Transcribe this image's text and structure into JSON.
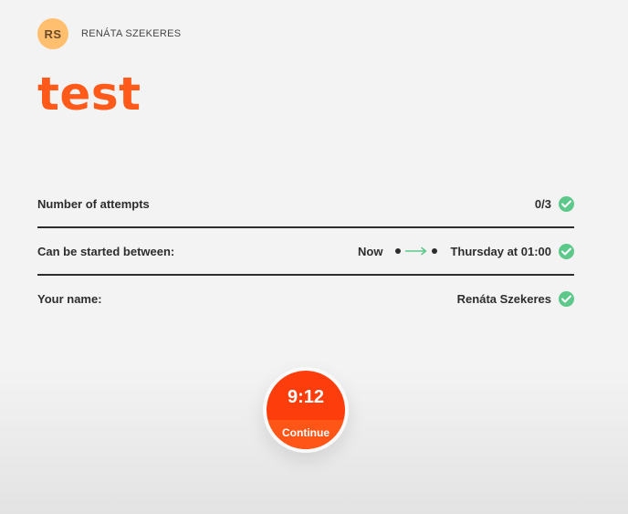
{
  "user": {
    "initials": "RS",
    "name": "RENÁTA SZEKERES"
  },
  "test": {
    "title": "test"
  },
  "info": {
    "attempts_label": "Number of attempts",
    "attempts_value": "0/3",
    "window_label": "Can be started between:",
    "window_from": "Now",
    "window_to": "Thursday at 01:00",
    "name_label": "Your name:",
    "name_value": "Renáta Szekeres"
  },
  "timer": {
    "time": "9:12",
    "action_label": "Continue"
  },
  "colors": {
    "accent": "#ff5a1a",
    "timer_top": "#fe3d0d",
    "timer_bottom": "#ff5517",
    "check": "#5cc98a",
    "avatar": "#ffbf6e",
    "arrow": "#5cc98a"
  },
  "icons": {
    "check": "check-icon",
    "arrow": "arrow-right-icon"
  }
}
